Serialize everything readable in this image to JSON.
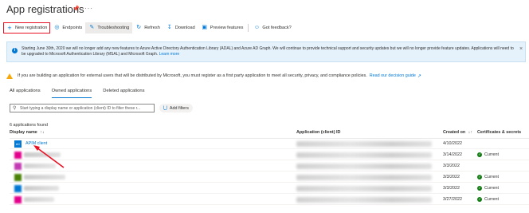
{
  "header": {
    "title": "App registrations"
  },
  "toolbar": {
    "new_registration": "New registration",
    "endpoints": "Endpoints",
    "troubleshooting": "Troubleshooting",
    "refresh": "Refresh",
    "download": "Download",
    "preview_features": "Preview features",
    "got_feedback": "Got feedback?"
  },
  "info_banner": {
    "text": "Starting June 30th, 2020 we will no longer add any new features to Azure Active Directory Authentication Library (ADAL) and Azure AD Graph. We will continue to provide technical support and security updates but we will no longer provide feature updates. Applications will need to be upgraded to Microsoft Authentication Library (MSAL) and Microsoft Graph.",
    "link": "Learn more"
  },
  "warning": {
    "text": "If you are building an application for external users that will be distributed by Microsoft, you must register as a first party application to meet all security, privacy, and compliance policies.",
    "link": "Read our decision guide"
  },
  "tabs": [
    {
      "label": "All applications",
      "active": false
    },
    {
      "label": "Owned applications",
      "active": true
    },
    {
      "label": "Deleted applications",
      "active": false
    }
  ],
  "search": {
    "placeholder": "Start typing a display name or application (client) ID to filter these r..."
  },
  "filters": {
    "add_label": "Add filters"
  },
  "results": {
    "count_text": "6 applications found"
  },
  "table": {
    "columns": {
      "display_name": "Display name",
      "app_id": "Application (client) ID",
      "created_on": "Created on",
      "certificates": "Certificates & secrets"
    },
    "rows": [
      {
        "avatar": "AC",
        "name": "APIM client",
        "created": "4/10/2022",
        "cert": ""
      },
      {
        "avatar": "",
        "name": "",
        "created": "3/14/2022",
        "cert": "Current"
      },
      {
        "avatar": "",
        "name": "",
        "created": "3/3/2022",
        "cert": ""
      },
      {
        "avatar": "",
        "name": "",
        "created": "3/3/2022",
        "cert": "Current"
      },
      {
        "avatar": "",
        "name": "",
        "created": "3/3/2022",
        "cert": "Current"
      },
      {
        "avatar": "",
        "name": "",
        "created": "3/27/2022",
        "cert": "Current"
      }
    ]
  },
  "colors": {
    "accent": "#0078d4",
    "highlight_box": "#e81123",
    "banner_bg": "#e5f1fb",
    "warning": "#f7a90a",
    "success": "#107c10",
    "avatar_colors": [
      "#0078d4",
      "#e3008c",
      "#c239b3",
      "#498205",
      "#0078d4",
      "#e3008c"
    ]
  },
  "icons": {
    "pin": "pin-icon",
    "more": "more-icon",
    "new": "plus-icon",
    "endpoints": "globe-icon",
    "troubleshooting": "wrench-icon",
    "refresh": "refresh-icon",
    "download": "download-icon",
    "preview": "preview-icon",
    "feedback": "feedback-icon",
    "info": "info-icon",
    "warning": "warning-icon",
    "search": "search-icon",
    "filter": "add-filter-icon",
    "sort": "sort-icon",
    "check": "check-icon"
  }
}
